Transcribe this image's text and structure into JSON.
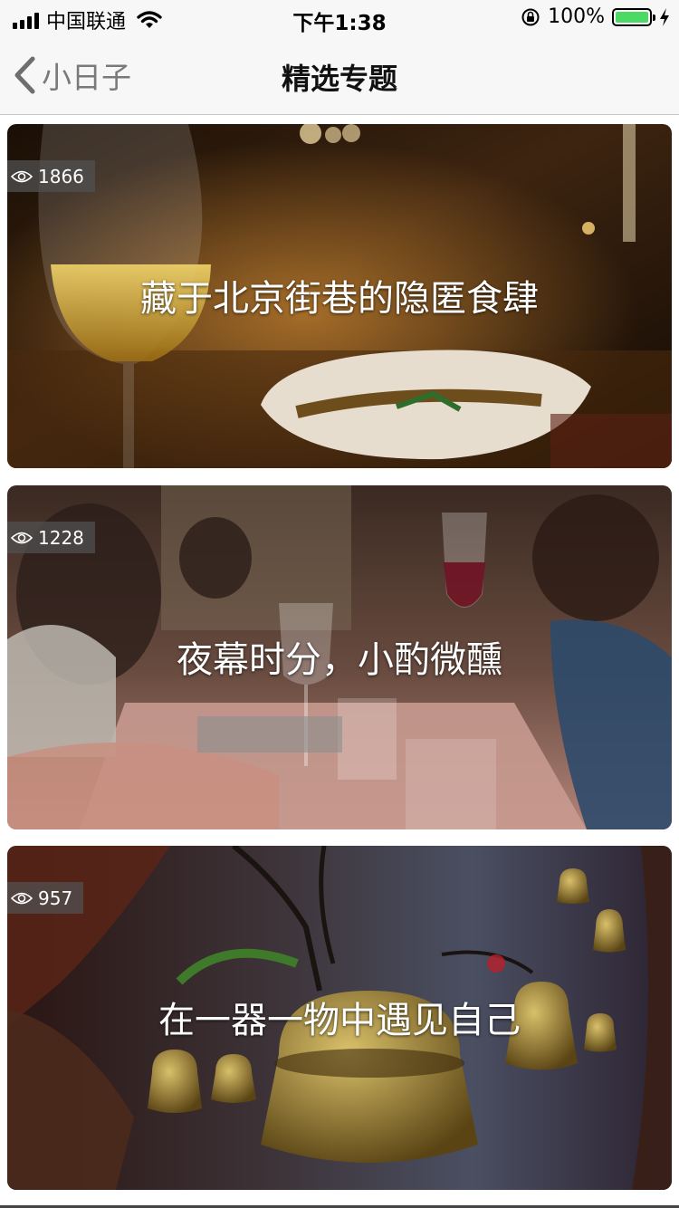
{
  "status_bar": {
    "carrier": "中国联通",
    "time": "下午1:38",
    "battery": "100%",
    "battery_level": 1.0,
    "battery_color": "#4cd964"
  },
  "nav": {
    "back_label": "小日子",
    "title": "精选专题"
  },
  "topics": [
    {
      "title": "藏于北京街巷的隐匿食肆",
      "views": "1866"
    },
    {
      "title": "夜幕时分，小酌微醺",
      "views": "1228"
    },
    {
      "title": "在一器一物中遇见自己",
      "views": "957"
    }
  ]
}
